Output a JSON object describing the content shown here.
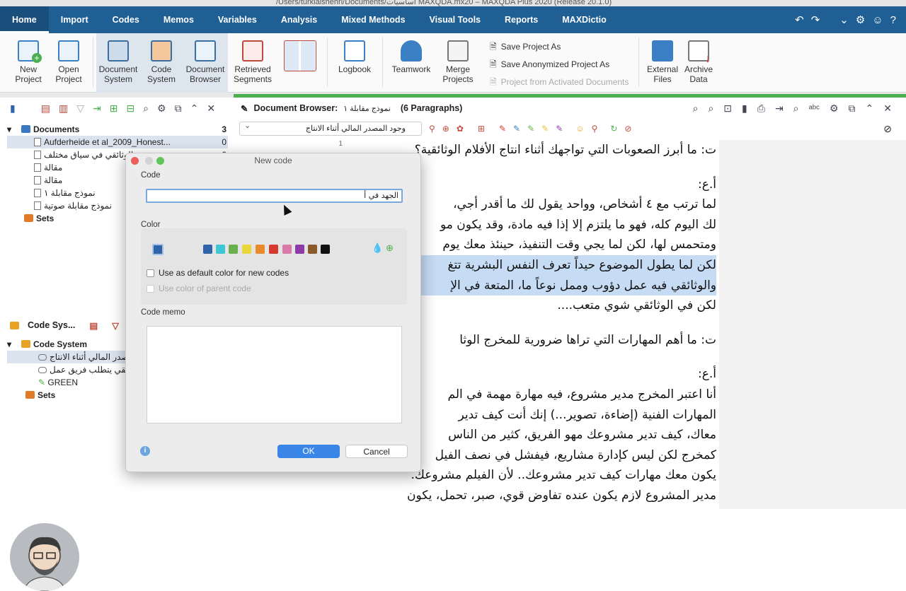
{
  "window": {
    "title": "/Users/turkialshehri/Documents/أساسيات MAXQDA.mx20 – MAXQDA Plus 2020 (Release 20.1.0)"
  },
  "menu": {
    "items": [
      "Home",
      "Import",
      "Codes",
      "Memos",
      "Variables",
      "Analysis",
      "Mixed Methods",
      "Visual Tools",
      "Reports",
      "MAXDictio"
    ],
    "active": "Home"
  },
  "ribbon": {
    "new_project": "New\nProject",
    "open_project": "Open\nProject",
    "document_system": "Document\nSystem",
    "code_system": "Code\nSystem",
    "document_browser": "Document\nBrowser",
    "retrieved_segments": "Retrieved\nSegments",
    "logbook": "Logbook",
    "teamwork": "Teamwork",
    "merge_projects": "Merge\nProjects",
    "save_project_as": "Save Project As",
    "save_anonymized": "Save Anonymized Project As",
    "project_from_activated": "Project from Activated Documents",
    "external_files": "External\nFiles",
    "archive_data": "Archive\nData"
  },
  "documents": {
    "header": "Documents",
    "count": "3",
    "items": [
      {
        "label": "Aufderheide et al_2009_Honest...",
        "count": "0"
      },
      {
        "label": "الوثائقي في سياق مختلف",
        "count": "0"
      },
      {
        "label": "مقالة",
        "count": ""
      },
      {
        "label": "مقالة",
        "count": ""
      },
      {
        "label": "نموذج مقابلة ١",
        "count": ""
      },
      {
        "label": "نموذج مقابلة صوتية",
        "count": ""
      }
    ],
    "sets": "Sets"
  },
  "code_system": {
    "panel_title": "Code Sys...",
    "header": "Code System",
    "items": [
      "وجود المصدر المالي أثناء الانتاج",
      "الوثائقي يتطلب فريق عمل",
      "GREEN"
    ],
    "sets": "Sets"
  },
  "browser": {
    "title": "Document Browser:",
    "doc_name": "نموذج مقابلة ١",
    "paragraphs": "(6 Paragraphs)",
    "code_combo": "وجود المصدر المالي أثناء الانتاج",
    "para_number": "1",
    "lines": [
      "ت: ما أبرز الصعوبات التي تواجهك أثناء انتاج الأفلام الوثائقية؟",
      "",
      "أ.ع:",
      "لما ترتب مع ٤ أشخاص، وواحد يقول لك ما أقدر أجي،",
      "لك اليوم كله، فهو ما يلتزم إلا إذا فيه مادة، وقد يكون مو",
      "ومتحمس لها، لكن لما يجي وقت التنفيذ، حينئذ معك يوم",
      "لكن لما يطول الموضوع حيداً تعرف النفس البشرية تتغ",
      "والوثائقي فيه عمل دؤوب وممل نوعاً ما، المتعة في الإ",
      "لكن في الوثائقي شوي متعب....",
      "",
      "ت: ما أهم المهارات التي تراها ضرورية للمخرج الوثا",
      "",
      "أ.ع:",
      "أنا اعتبر المخرج مدير مشروع، فيه مهارة مهمة في الم",
      "المهارات الفنية (إضاءة، تصوير...) إنك أنت كيف تدير",
      "معاك، كيف تدير مشروعك مهو الفريق، كثير من الناس",
      "كمخرج لكن ليس كإدارة مشاريع، فيفشل في نصف الفيل",
      "يكون معك مهارات كيف تدير مشروعك.. لأن الفيلم مشروعك.",
      "مدير المشروع لازم يكون عنده تفاوض قوي، صبر، تحمل، يكون"
    ]
  },
  "dialog": {
    "title": "New code",
    "code_label": "Code",
    "code_value": "الجهد في أ",
    "color_label": "Color",
    "selected_color": "#2f64a8",
    "palette": [
      "#2f64a8",
      "#3ec5d6",
      "#6ab04c",
      "#e8d63a",
      "#e8892a",
      "#d63a2f",
      "#d97aa8",
      "#8e3aa8",
      "#8a5a2b",
      "#111111"
    ],
    "default_color_label": "Use as default color for new codes",
    "parent_color_label": "Use color of parent code",
    "memo_label": "Code memo",
    "ok": "OK",
    "cancel": "Cancel"
  }
}
